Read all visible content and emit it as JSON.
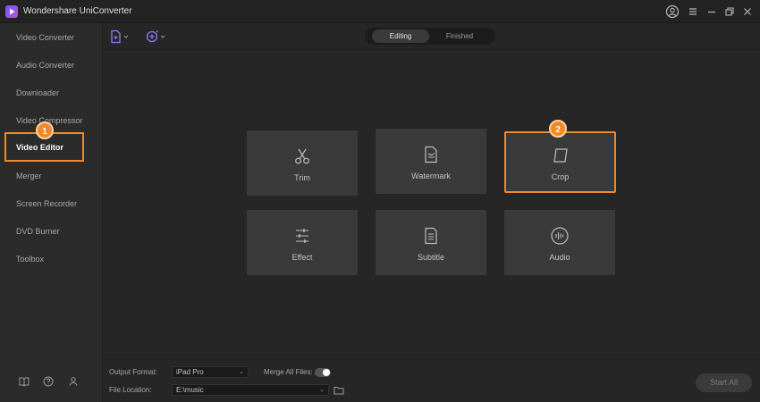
{
  "app": {
    "title": "Wondershare UniConverter"
  },
  "sidebar": {
    "items": [
      {
        "label": "Video Converter"
      },
      {
        "label": "Audio Converter"
      },
      {
        "label": "Downloader"
      },
      {
        "label": "Video Compressor"
      },
      {
        "label": "Video Editor",
        "active": true
      },
      {
        "label": "Merger"
      },
      {
        "label": "Screen Recorder"
      },
      {
        "label": "DVD Burner"
      },
      {
        "label": "Toolbox"
      }
    ],
    "bottom_icons": [
      "book-icon",
      "help-icon",
      "account-icon"
    ]
  },
  "annotations": {
    "badge1": "1",
    "badge2": "2",
    "accent": "#f0892a"
  },
  "topbar": {
    "tabs": [
      {
        "label": "Editing",
        "selected": true
      },
      {
        "label": "Finished",
        "selected": false
      }
    ],
    "tools": [
      "add-file-icon",
      "add-media-icon"
    ]
  },
  "tiles": [
    {
      "label": "Trim",
      "icon": "scissors-icon"
    },
    {
      "label": "Watermark",
      "icon": "watermark-icon"
    },
    {
      "label": "Crop",
      "icon": "crop-icon",
      "highlighted": true
    },
    {
      "label": "Effect",
      "icon": "effect-icon"
    },
    {
      "label": "Subtitle",
      "icon": "subtitle-icon"
    },
    {
      "label": "Audio",
      "icon": "audio-icon"
    }
  ],
  "bottom": {
    "output_format_label": "Output Format:",
    "output_format_value": "iPad Pro",
    "merge_label": "Merge All Files:",
    "merge_on": false,
    "file_location_label": "File Location:",
    "file_location_value": "E:\\music",
    "start_all_label": "Start All"
  },
  "colors": {
    "accent_purple": "#8b7cff",
    "highlight_orange": "#f0892a"
  }
}
